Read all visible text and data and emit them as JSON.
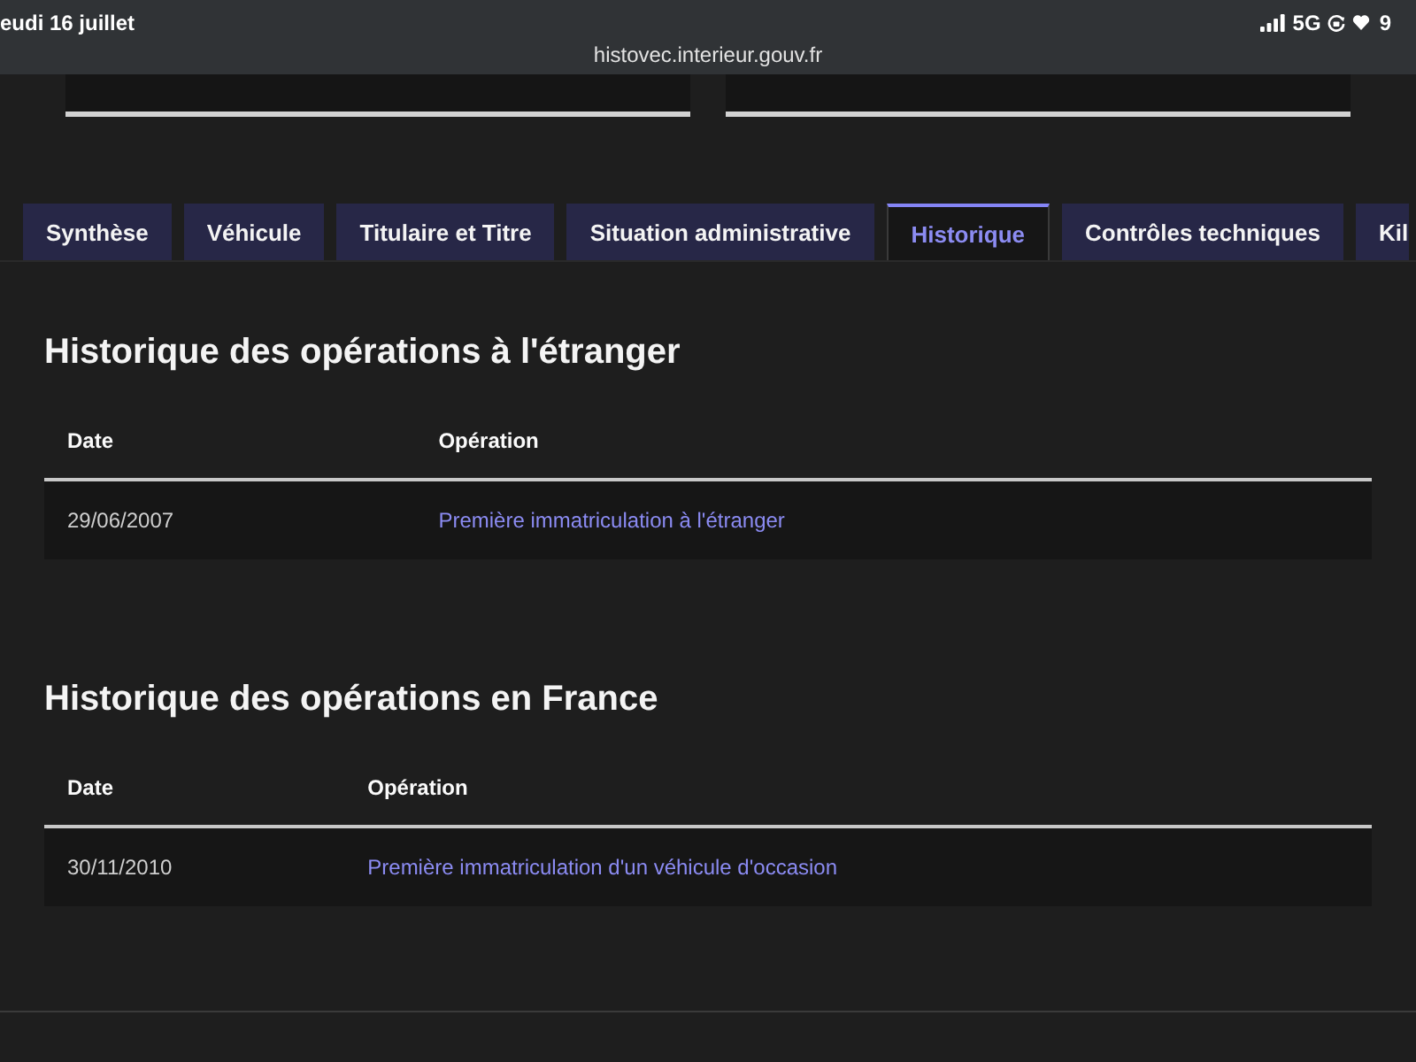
{
  "status_bar": {
    "date": "eudi 16 juillet",
    "network": "5G",
    "battery": "9"
  },
  "address_bar": {
    "url": "histovec.interieur.gouv.fr"
  },
  "tabs": [
    {
      "label": "Synthèse",
      "selected": false
    },
    {
      "label": "Véhicule",
      "selected": false
    },
    {
      "label": "Titulaire et Titre",
      "selected": false
    },
    {
      "label": "Situation administrative",
      "selected": false
    },
    {
      "label": "Historique",
      "selected": true
    },
    {
      "label": "Contrôles techniques",
      "selected": false
    },
    {
      "label": "Kil",
      "selected": false
    }
  ],
  "sections": [
    {
      "title": "Historique des opérations à l'étranger",
      "table": {
        "columns": [
          "Date",
          "Opération"
        ],
        "rows": [
          {
            "date": "29/06/2007",
            "operation": "Première immatriculation à l'étranger"
          }
        ]
      }
    },
    {
      "title": "Historique des opérations en France",
      "table": {
        "columns": [
          "Date",
          "Opération"
        ],
        "rows": [
          {
            "date": "30/11/2010",
            "operation": "Première immatriculation d'un véhicule d'occasion"
          }
        ]
      }
    }
  ]
}
